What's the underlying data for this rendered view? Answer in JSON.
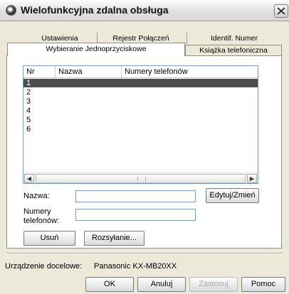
{
  "window": {
    "title": "Wielofunkcyjna zdalna obsługa"
  },
  "tabs": {
    "row1": [
      "Ustawienia",
      "Rejestr Połączeń",
      "Identif. Numer"
    ],
    "row2": [
      "Wybieranie Jednoprzyciskowe",
      "Książka telefoniczna"
    ],
    "active": "Wybieranie Jednoprzyciskowe"
  },
  "list": {
    "columns": [
      "Nr",
      "Nazwa",
      "Numery telefonów"
    ],
    "rows": [
      "1",
      "2",
      "3",
      "4",
      "5",
      "6"
    ],
    "selected_row": "1"
  },
  "form": {
    "name_label": "Nazwa:",
    "name_value": "",
    "numbers_label_line1": "Numery",
    "numbers_label_line2": "telefonów:",
    "numbers_value": "",
    "edit_button": "Edytuj/Zmień"
  },
  "buttons": {
    "delete": "Usuń",
    "broadcast": "Rozsyłanie...",
    "ok": "OK",
    "cancel": "Anuluj",
    "apply": "Zastosuj",
    "help": "Pomoc"
  },
  "device": {
    "label": "Urządzenie docelowe:",
    "value": "Panasonic  KX-MB20XX"
  },
  "icons": [
    "app-icon",
    "close-icon",
    "scroll-left-icon",
    "scroll-right-icon"
  ]
}
